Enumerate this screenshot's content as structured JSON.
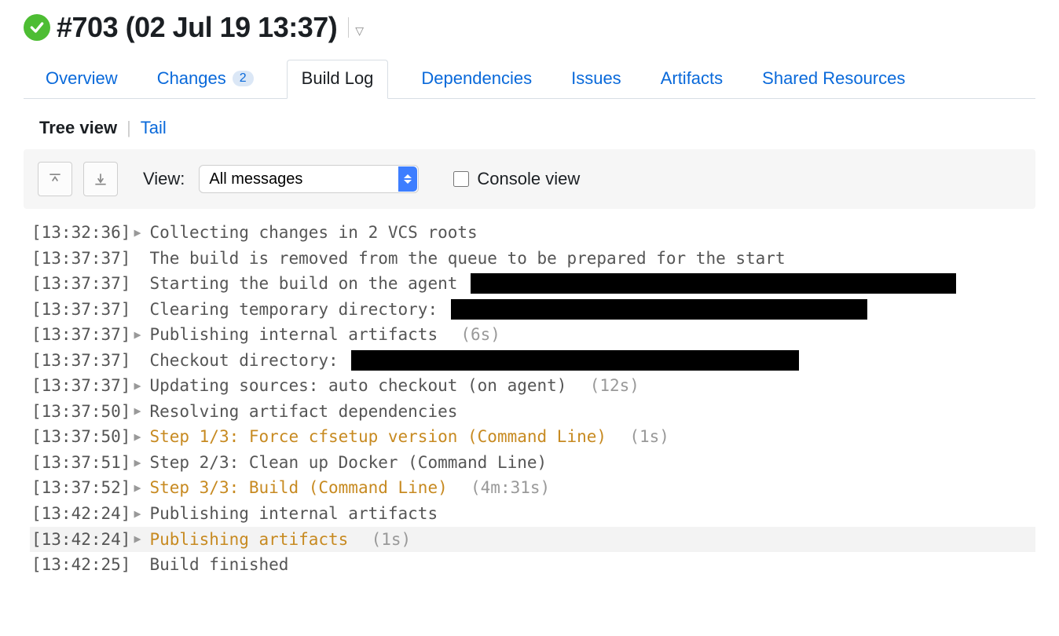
{
  "header": {
    "title": "#703 (02 Jul 19 13:37)"
  },
  "tabs": {
    "overview": "Overview",
    "changes": "Changes",
    "changes_badge": "2",
    "buildlog": "Build Log",
    "dependencies": "Dependencies",
    "issues": "Issues",
    "artifacts": "Artifacts",
    "shared": "Shared Resources"
  },
  "viewmode": {
    "tree": "Tree view",
    "tail": "Tail"
  },
  "toolbar": {
    "view_label": "View:",
    "select_value": "All messages",
    "console_label": "Console view"
  },
  "log": {
    "rows": [
      {
        "ts": "[13:32:36]",
        "expand": true,
        "msg": "Collecting changes in 2 VCS roots",
        "cls": "",
        "dur": "",
        "redact": 0
      },
      {
        "ts": "[13:37:37]",
        "expand": false,
        "msg": "The build is removed from the queue to be prepared for the start",
        "cls": "",
        "dur": "",
        "redact": 0
      },
      {
        "ts": "[13:37:37]",
        "expand": false,
        "msg": "Starting the build on the agent ",
        "cls": "",
        "dur": "",
        "redact": 618
      },
      {
        "ts": "[13:37:37]",
        "expand": false,
        "msg": "Clearing temporary directory: ",
        "cls": "",
        "dur": "",
        "redact": 530
      },
      {
        "ts": "[13:37:37]",
        "expand": true,
        "msg": "Publishing internal artifacts",
        "cls": "",
        "dur": "(6s)",
        "redact": 0
      },
      {
        "ts": "[13:37:37]",
        "expand": false,
        "msg": "Checkout directory: ",
        "cls": "",
        "dur": "",
        "redact": 570
      },
      {
        "ts": "[13:37:37]",
        "expand": true,
        "msg": "Updating sources: auto checkout (on agent)",
        "cls": "",
        "dur": "(12s)",
        "redact": 0
      },
      {
        "ts": "[13:37:50]",
        "expand": true,
        "msg": "Resolving artifact dependencies",
        "cls": "",
        "dur": "",
        "redact": 0
      },
      {
        "ts": "[13:37:50]",
        "expand": true,
        "msg": "Step 1/3: Force cfsetup version (Command Line)",
        "cls": "orange",
        "dur": "(1s)",
        "redact": 0
      },
      {
        "ts": "[13:37:51]",
        "expand": true,
        "msg": "Step 2/3: Clean up Docker (Command Line)",
        "cls": "",
        "dur": "",
        "redact": 0
      },
      {
        "ts": "[13:37:52]",
        "expand": true,
        "msg": "Step 3/3: Build (Command Line)",
        "cls": "orange",
        "dur": "(4m:31s)",
        "redact": 0
      },
      {
        "ts": "[13:42:24]",
        "expand": true,
        "msg": "Publishing internal artifacts",
        "cls": "",
        "dur": "",
        "redact": 0
      },
      {
        "ts": "[13:42:24]",
        "expand": true,
        "msg": "Publishing artifacts",
        "cls": "orange",
        "dur": "(1s)",
        "redact": 0,
        "highlight": true
      },
      {
        "ts": "[13:42:25]",
        "expand": false,
        "msg": "Build finished",
        "cls": "",
        "dur": "",
        "redact": 0
      }
    ]
  }
}
